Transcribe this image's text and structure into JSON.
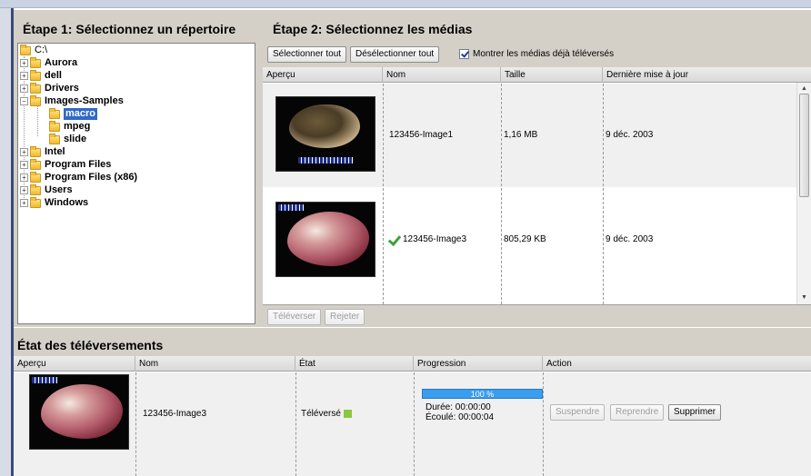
{
  "step1": {
    "title": "Étape 1: Sélectionnez un répertoire",
    "tree": {
      "root": "C:\\",
      "items": [
        "Aurora",
        "dell",
        "Drivers",
        "Images-Samples",
        "macro",
        "mpeg",
        "slide",
        "Intel",
        "Program Files",
        "Program Files (x86)",
        "Users",
        "Windows"
      ],
      "selected": "macro"
    }
  },
  "step2": {
    "title": "Étape 2: Sélectionnez les médias",
    "select_all": "Sélectionner tout",
    "deselect_all": "Désélectionner tout",
    "show_uploaded_label": "Montrer les médias déjà téléversés",
    "show_uploaded_checked": true,
    "columns": [
      "Aperçu",
      "Nom",
      "Taille",
      "Dernière mise à jour"
    ],
    "rows": [
      {
        "name": "123456-Image1",
        "size": "1,16 MB",
        "date": "9 déc. 2003",
        "checked": false
      },
      {
        "name": "123456-Image3",
        "size": "805,29 KB",
        "date": "9 déc. 2003",
        "checked": true
      }
    ],
    "upload_button": "Téléverser",
    "reject_button": "Rejeter"
  },
  "uploads": {
    "title": "État des téléversements",
    "columns": [
      "Aperçu",
      "Nom",
      "État",
      "Progression",
      "Action"
    ],
    "row": {
      "name": "123456-Image3",
      "status": "Téléversé",
      "progress_text": "100 %",
      "progress_percent": 100,
      "duration": "Durée: 00:00:00",
      "elapsed": "Écoulé: 00:00:04",
      "suspend": "Suspendre",
      "resume": "Reprendre",
      "delete": "Supprimer"
    }
  },
  "colors": {
    "panel_bg": "#d4d0c8",
    "selection": "#3169c6",
    "progress": "#3a9ef0",
    "status_ok": "#8ac840"
  }
}
